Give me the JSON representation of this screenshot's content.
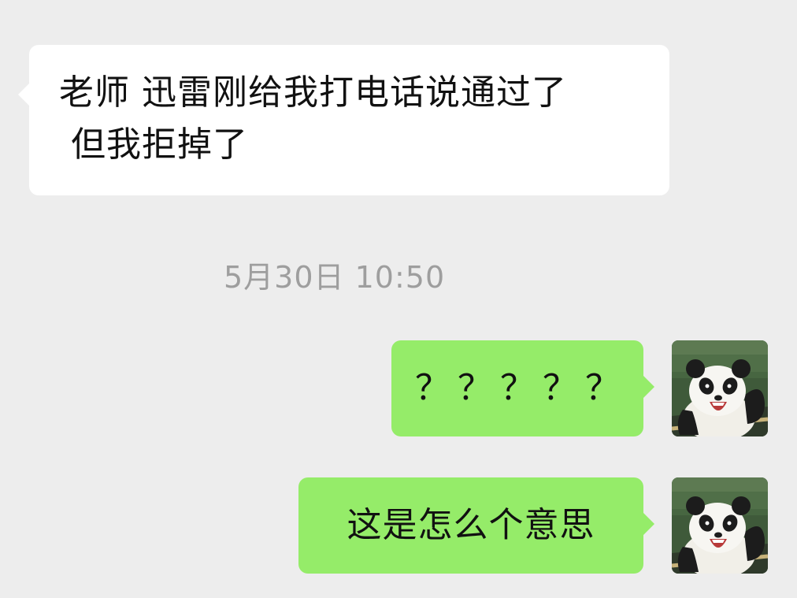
{
  "messages": [
    {
      "sender": "contact",
      "text": "老师 迅雷刚给我打电话说通过了\n 但我拒掉了"
    },
    {
      "sender": "self",
      "text": "？？？？？"
    },
    {
      "sender": "self",
      "text": "这是怎么个意思"
    }
  ],
  "timestamp": "5月30日 10:50",
  "colors": {
    "background": "#ededed",
    "incoming_bubble": "#ffffff",
    "outgoing_bubble": "#95ec69",
    "timestamp_text": "#9e9e9e"
  },
  "avatar": {
    "icon": "panda-avatar-icon"
  }
}
